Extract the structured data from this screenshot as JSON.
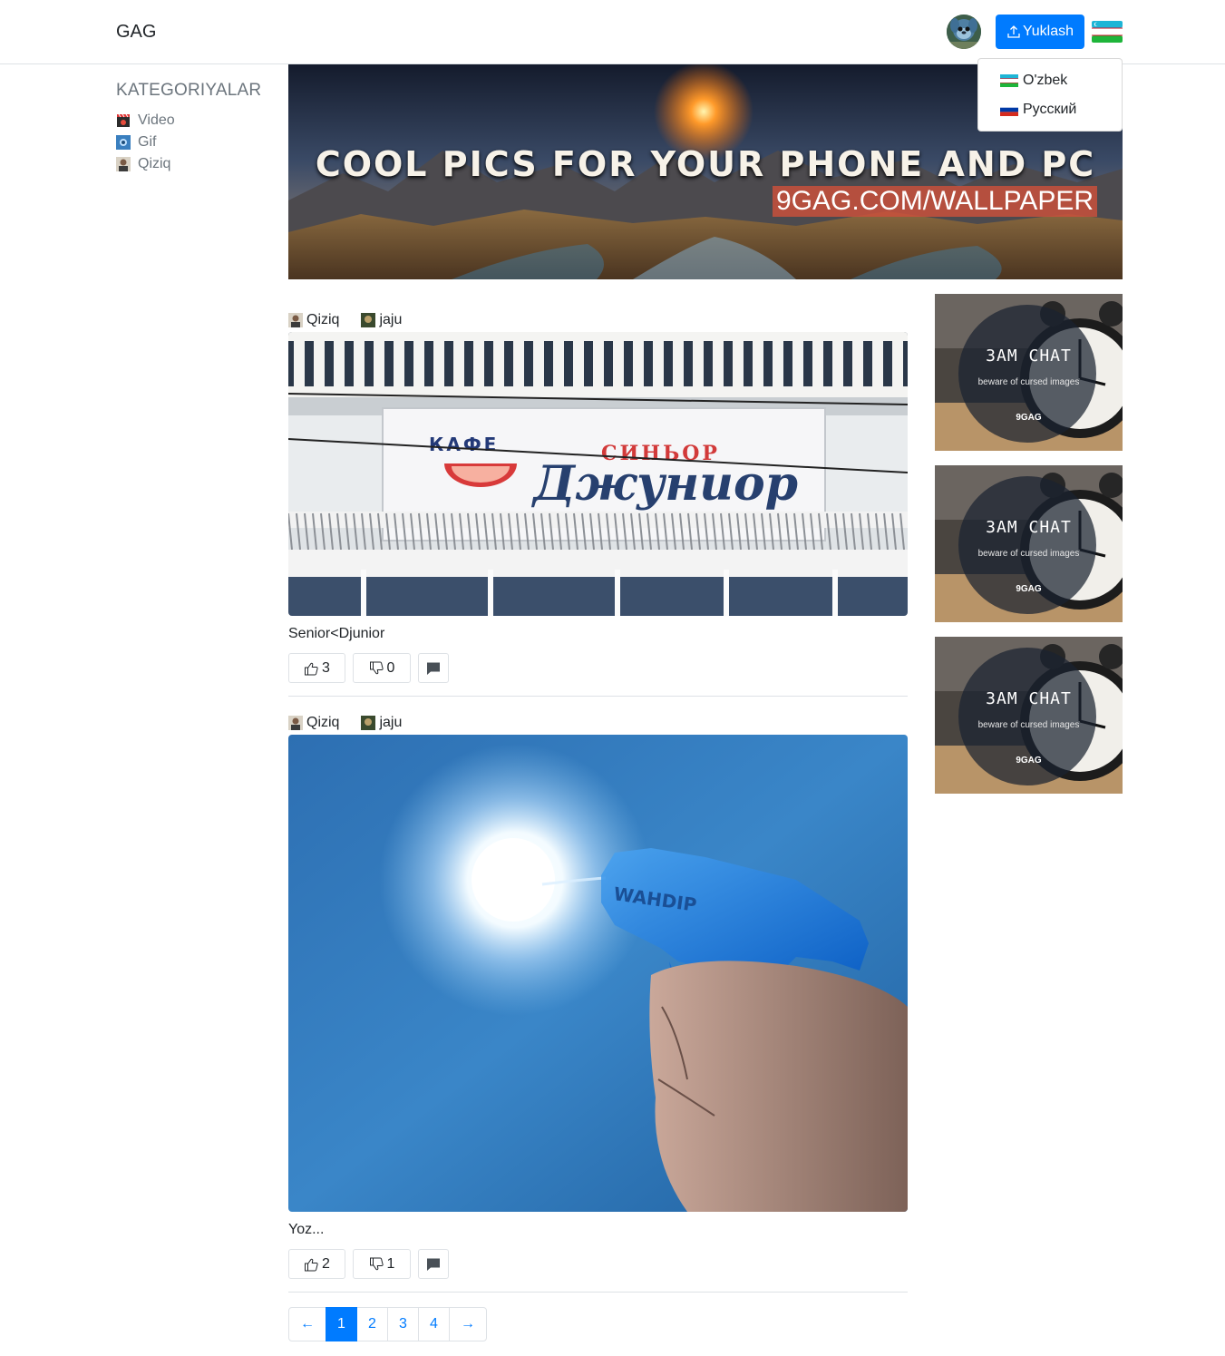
{
  "navbar": {
    "brand": "GAG",
    "upload_label": "Yuklash",
    "language_menu": [
      {
        "label": "O'zbek",
        "flag": "uz-flag-icon"
      },
      {
        "label": "Русский",
        "flag": "ru-flag-icon"
      }
    ]
  },
  "sidebar": {
    "title": "KATEGORIYALAR",
    "items": [
      {
        "label": "Video",
        "icon": "video-category-icon"
      },
      {
        "label": "Gif",
        "icon": "gif-category-icon"
      },
      {
        "label": "Qiziq",
        "icon": "qiziq-category-icon"
      }
    ]
  },
  "banner": {
    "headline": "COOL PICS FOR YOUR PHONE AND PC",
    "url": "9GAG.COM/WALLPAPER"
  },
  "posts": [
    {
      "category": "Qiziq",
      "author": "jaju",
      "title": "Senior<Djunior",
      "upvotes": "3",
      "downvotes": "0",
      "sign_small": "КАФЕ",
      "sign_top": "СИНЬОР",
      "sign_main": "Джуниор"
    },
    {
      "category": "Qiziq",
      "author": "jaju",
      "title": "Yoz...",
      "upvotes": "2",
      "downvotes": "1",
      "gun_text": "WAHDIP"
    }
  ],
  "ads": [
    {
      "title": "3AM CHAT",
      "subtitle": "beware of cursed images",
      "brand": "9GAG"
    },
    {
      "title": "3AM CHAT",
      "subtitle": "beware of cursed images",
      "brand": "9GAG"
    },
    {
      "title": "3AM CHAT",
      "subtitle": "beware of cursed images",
      "brand": "9GAG"
    }
  ],
  "pagination": {
    "prev": "←",
    "pages": [
      "1",
      "2",
      "3",
      "4"
    ],
    "active": "1",
    "next": "→"
  },
  "colors": {
    "primary": "#007bff",
    "muted": "#6c757d",
    "border": "#dee2e6"
  }
}
